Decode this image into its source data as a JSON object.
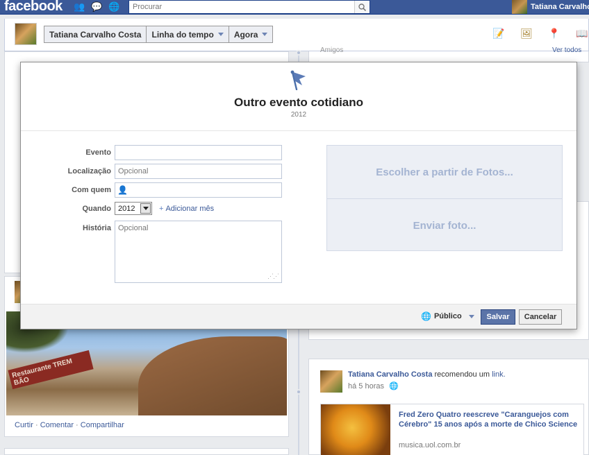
{
  "topbar": {
    "logo": "facebook",
    "search_placeholder": "Procurar",
    "user_name": "Tatiana Carvalho"
  },
  "timeline_header": {
    "name_button": "Tatiana Carvalho Costa",
    "timeline_button": "Linha do tempo",
    "now_button": "Agora"
  },
  "background": {
    "friends_label": "Amigos",
    "see_all": "Ver todos",
    "photo_actions": {
      "like": "Curtir",
      "comment": "Comentar",
      "share": "Compartilhar"
    },
    "photo_sign_text": "Restaurante TREM BÃO",
    "post": {
      "author": "Tatiana Carvalho Costa",
      "action": "recomendou um",
      "link_word": "link.",
      "time": "há 5 horas",
      "share_title": "Fred Zero Quatro reescreve \"Caranguejos com Cérebro\" 15 anos após a morte de Chico Science",
      "share_domain": "musica.uol.com.br"
    }
  },
  "dialog": {
    "title": "Outro evento cotidiano",
    "year": "2012",
    "fields": {
      "event_label": "Evento",
      "event_value": "",
      "location_label": "Localização",
      "location_placeholder": "Opcional",
      "with_label": "Com quem",
      "when_label": "Quando",
      "when_year": "2012",
      "add_month": "Adicionar mês",
      "story_label": "História",
      "story_placeholder": "Opcional"
    },
    "photo_options": {
      "choose": "Escolher a partir de Fotos...",
      "upload": "Enviar foto..."
    },
    "footer": {
      "privacy": "Público",
      "save": "Salvar",
      "cancel": "Cancelar"
    }
  }
}
